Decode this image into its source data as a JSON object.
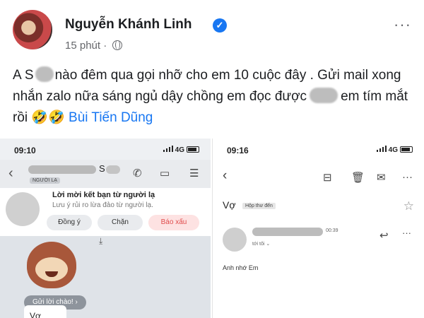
{
  "post": {
    "author": "Nguyễn Khánh Linh",
    "time": "15 phút",
    "more_glyph": "···",
    "verified_glyph": "✓",
    "text_part1": "A S",
    "text_part2": "nào đêm qua gọi nhỡ cho em 10 cuộc đây . Gửi mail xong nhắn zalo nữa sáng ngủ dậy chồng em đọc được",
    "text_part3": "em tím mắt rồi",
    "emojis": "🤣🤣",
    "tagged": "Bùi Tiến Dũng"
  },
  "zalo": {
    "time": "09:10",
    "network": "4G",
    "contact_initial": "S",
    "stranger_badge": "NGƯỜI LẠ",
    "card_title": "Lời mời kết bạn từ người lạ",
    "card_subtitle": "Lưu ý rủi ro lừa đảo từ người lạ.",
    "btn_accept": "Đồng ý",
    "btn_block": "Chặn",
    "btn_report": "Báo xấu",
    "greet_button": "Gửi lời chào! ›",
    "message": "Vợ",
    "icons": [
      "back-icon",
      "phone-icon",
      "video-icon",
      "menu-icon",
      "download-icon"
    ]
  },
  "mail": {
    "time": "09:16",
    "network": "4G",
    "subject": "Vợ",
    "label": "Hộp thư đến",
    "msg_time": "00:39",
    "to": "tới tôi ⌄",
    "body": "Anh nhớ Em",
    "icons": [
      "back-icon",
      "archive-icon",
      "trash-icon",
      "mail-icon",
      "more-icon",
      "star-icon",
      "reply-icon"
    ]
  },
  "colors": {
    "link": "#1877f2",
    "report": "#e04c4c",
    "verified": "#1877f2"
  }
}
